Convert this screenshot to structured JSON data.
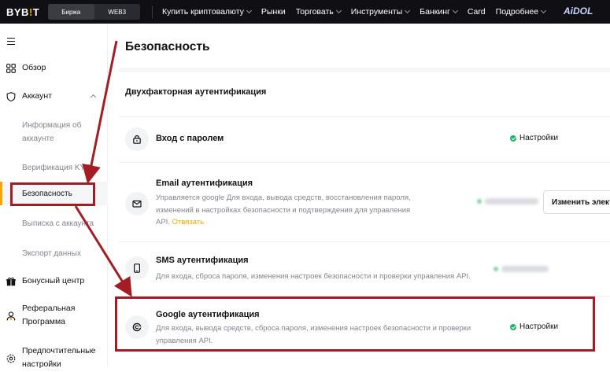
{
  "topnav": {
    "logo_left": "BYB",
    "logo_dot": "!",
    "logo_right": "T",
    "segments": [
      "Биржа",
      "WEB3"
    ],
    "items": [
      {
        "label": "Купить криптовалюту",
        "dropdown": true
      },
      {
        "label": "Рынки",
        "dropdown": false
      },
      {
        "label": "Торговать",
        "dropdown": true
      },
      {
        "label": "Инструменты",
        "dropdown": true
      },
      {
        "label": "Банкинг",
        "dropdown": true
      },
      {
        "label": "Card",
        "dropdown": false
      },
      {
        "label": "Подробнее",
        "dropdown": true
      }
    ],
    "brand": "AiDOL"
  },
  "sidebar": {
    "items": [
      {
        "label": "Обзор",
        "icon": "overview-grid-icon"
      },
      {
        "label": "Аккаунт",
        "icon": "shield-icon"
      },
      {
        "label": "Информация об аккаунте"
      },
      {
        "label": "Верификация KYC"
      },
      {
        "label": "Безопасность"
      },
      {
        "label": "Выписка с аккаунта"
      },
      {
        "label": "Экспорт данных"
      },
      {
        "label": "Бонусный центр",
        "icon": "gift-icon"
      },
      {
        "label": "Реферальная Программа",
        "icon": "referral-icon"
      },
      {
        "label": "Предпочтительные настройки",
        "icon": "settings-gear-icon"
      }
    ]
  },
  "main": {
    "title": "Безопасность",
    "section_title": "Двухфакторная аутентификация",
    "rows": [
      {
        "title": "Вход с паролем",
        "status": "Настройки"
      },
      {
        "title": "Email аутентификация",
        "desc_line1": "Управляется google    Для входа, вывода средств, восстановления пароля,",
        "desc_line2": "изменений в настройках безопасности и подтверждения для управления",
        "desc_line3_prefix": "API.",
        "desc_link": "Отвязать",
        "button": "Изменить элект"
      },
      {
        "title": "SMS аутентификация",
        "desc_line1": "Для входа, сброса пароля, изменения настроек безопасности и проверки управления API."
      },
      {
        "title": "Google аутентификация",
        "desc_line1": "Для входа, вывода средств, сброса пароля, изменения настроек безопасности и проверки",
        "desc_line2": "управления API.",
        "status": "Настройки"
      }
    ]
  },
  "colors": {
    "accent": "#f7a600",
    "success": "#20b26c",
    "annotation": "#a51d24",
    "topbar": "#101014"
  }
}
